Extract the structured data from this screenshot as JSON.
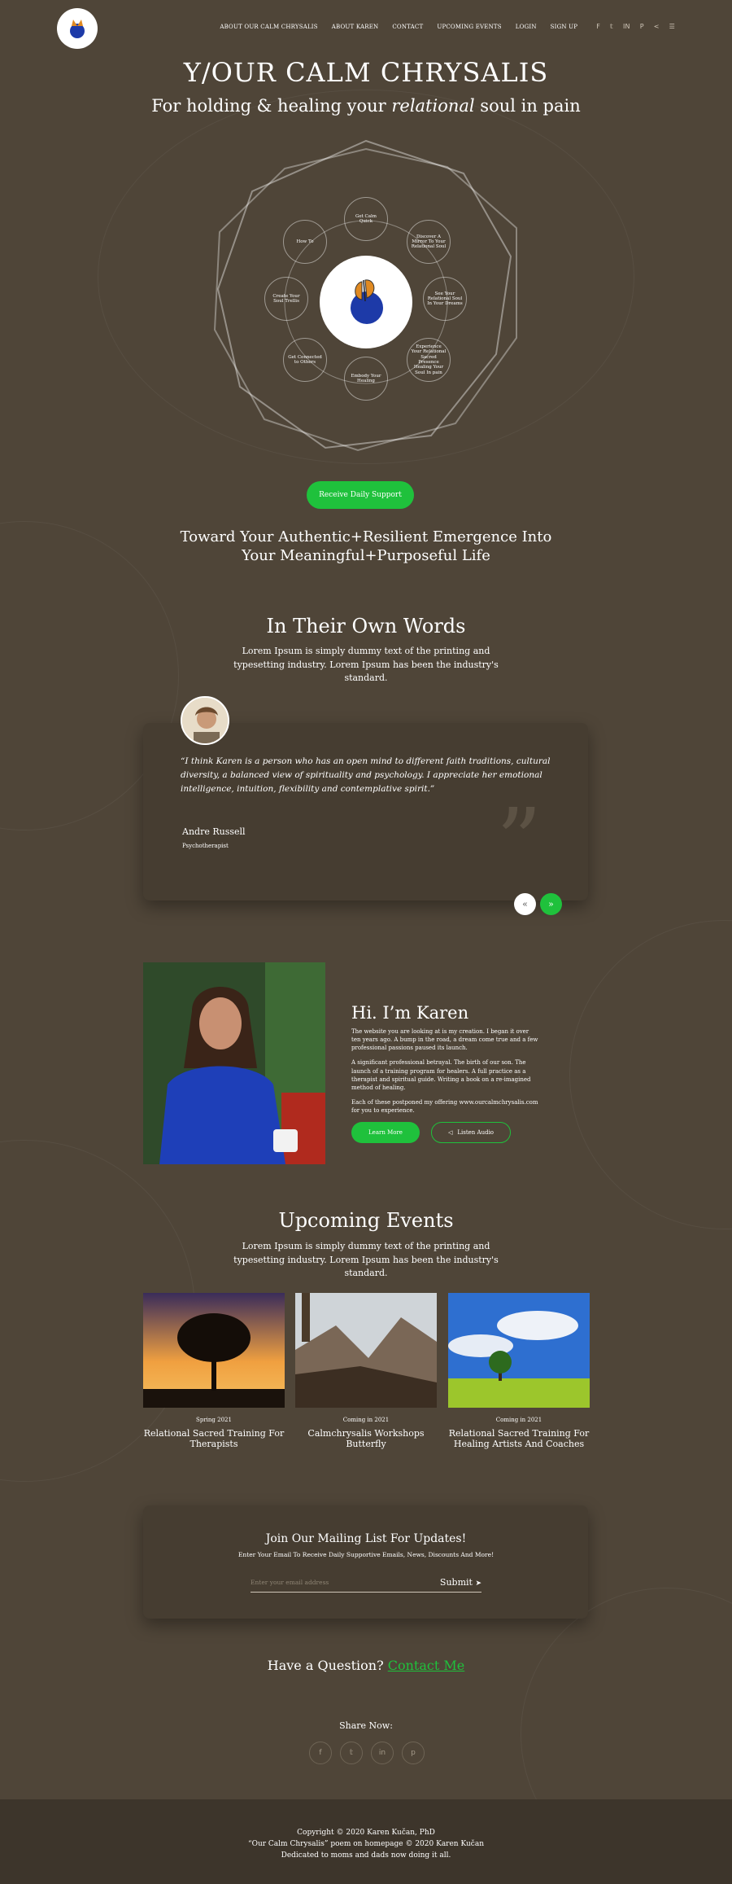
{
  "nav": {
    "items": [
      "ABOUT OUR CALM CHRYSALIS",
      "ABOUT KAREN",
      "CONTACT",
      "UPCOMING EVENTS",
      "LOGIN",
      "SIGN UP"
    ],
    "socials": [
      "f",
      "t",
      "in",
      "p",
      "share"
    ],
    "menu_icon": "menu-icon"
  },
  "hero": {
    "title": "Y/OUR CALM CHRYSALIS",
    "subtitle_pre": "For holding & healing your ",
    "subtitle_em": "relational",
    "subtitle_post": " soul in pain"
  },
  "wheel": {
    "nodes": [
      "Get Calm Quick",
      "Discover A Mirror To Your Relational Soul",
      "See Your Relational Soul In Your Dreams",
      "Experience Your Relational Sacred Presence Healing Your Soul In pain",
      "Embody Your Healing",
      "Get Connected to Others",
      "Create Your Soul Trellis",
      "How To"
    ]
  },
  "cta": {
    "label": "Receive Daily Support"
  },
  "tagline": {
    "line1": "Toward Your Authentic+Resilient Emergence Into",
    "line2": "Your Meaningful+Purposeful Life"
  },
  "testimonials": {
    "title": "In Their Own Words",
    "desc": "Lorem Ipsum is simply dummy text of the printing and typesetting industry. Lorem Ipsum has been the industry's standard.",
    "quote": "“I think Karen is a person who has an open mind to different faith traditions, cultural diversity, a balanced view of spirituality and psychology. I appreciate her emotional intelligence, intuition, flexibility and contemplative spirit.”",
    "name": "Andre Russell",
    "role": "Psychotherapist",
    "prev": "«",
    "next": "»"
  },
  "karen": {
    "title": "Hi. I’m Karen",
    "p1": "The website you are looking at is my creation.  I began it over ten years ago.  A bump in the road, a dream come true and a few professional passions paused its launch.",
    "p2": "A significant professional betrayal. The birth of our son. The launch of a training program for healers.  A full practice as a therapist and spiritual guide. Writing a book on a re-imagined method of healing.",
    "p3": "Each of these postponed my offering www.ourcalmchrysalis.com for you to experience.",
    "learn": "Learn More",
    "listen": "Listen Audio"
  },
  "events": {
    "title": "Upcoming Events",
    "desc": "Lorem Ipsum is simply dummy text of the printing and typesetting industry. Lorem Ipsum has been the industry's standard.",
    "items": [
      {
        "date": "Spring 2021",
        "title": "Relational Sacred Training For Therapists"
      },
      {
        "date": "Coming in 2021",
        "title": "Calmchrysalis Workshops Butterfly"
      },
      {
        "date": "Coming in 2021",
        "title": "Relational Sacred Training For Healing Artists And Coaches"
      }
    ]
  },
  "mailing": {
    "title": "Join Our Mailing List For Updates!",
    "sub": "Enter Your Email To Receive Daily Supportive Emails, News, Discounts And More!",
    "placeholder": "Enter your email address",
    "submit": "Submit"
  },
  "question": {
    "text": "Have a Question? ",
    "link": "Contact Me"
  },
  "share": {
    "label": "Share Now:",
    "icons": [
      "f",
      "t",
      "in",
      "p"
    ]
  },
  "footer": {
    "line1": "Copyright © 2020 Karen Kučan, PhD",
    "line2": "“Our Calm Chrysalis” poem on homepage © 2020 Karen Kučan",
    "line3": "Dedicated to moms and dads now doing it all."
  },
  "colors": {
    "bg": "#4f4538",
    "card": "#463d31",
    "accent": "#1fc13c",
    "footer": "#3d352b"
  }
}
